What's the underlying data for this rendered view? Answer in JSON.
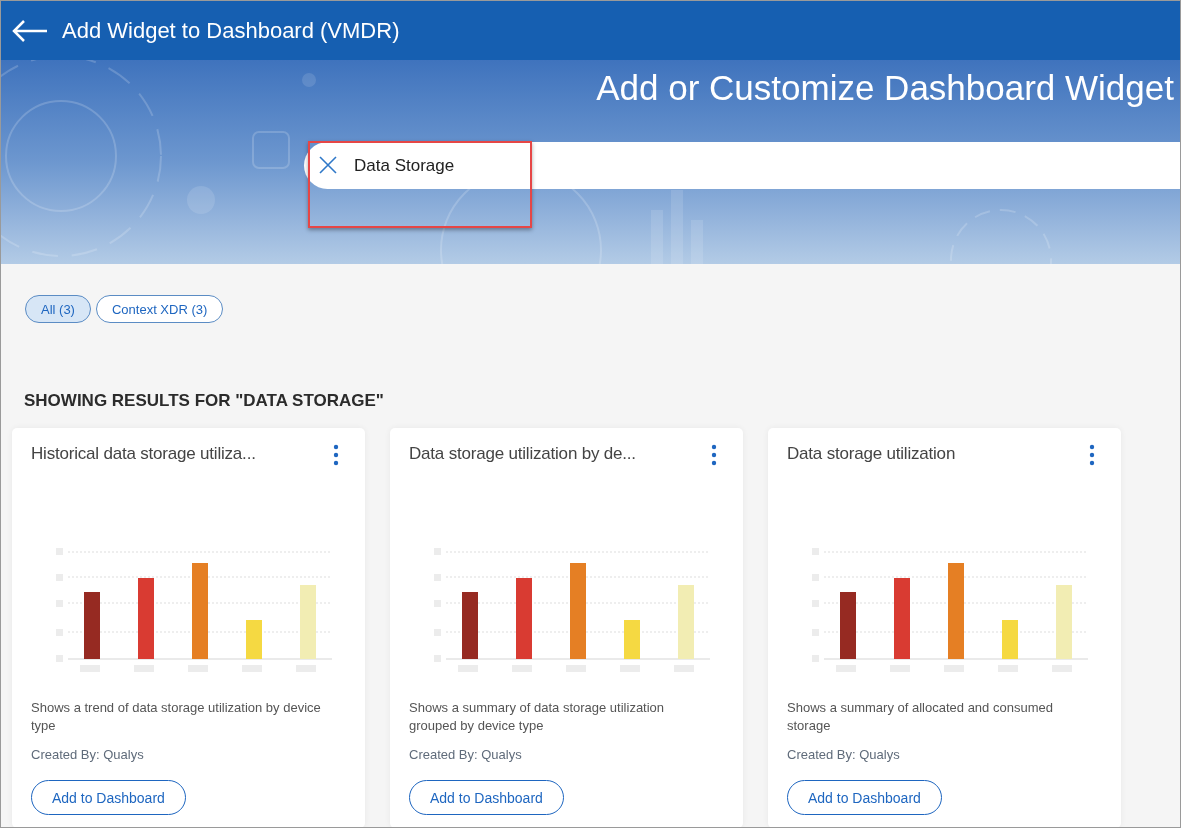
{
  "header": {
    "title": "Add Widget to Dashboard (VMDR)"
  },
  "banner": {
    "heading": "Add or Customize Dashboard Widget",
    "search": {
      "value": "Data Storage",
      "highlighted": true
    }
  },
  "filters": [
    {
      "label": "All (3)",
      "selected": true
    },
    {
      "label": "Context XDR (3)",
      "selected": false
    }
  ],
  "results_heading": "SHOWING RESULTS FOR \"DATA STORAGE\"",
  "cards": [
    {
      "title": "Historical data storage utiliza...",
      "description": "Shows a trend of data storage utilization by device type",
      "created_by": "Created By: Qualys",
      "button": "Add to Dashboard"
    },
    {
      "title": "Data storage utilization by de...",
      "description": "Shows a summary of data storage utilization grouped by device type",
      "created_by": "Created By: Qualys",
      "button": "Add to Dashboard"
    },
    {
      "title": "Data storage utilization",
      "description": "Shows a summary of allocated and consumed storage",
      "created_by": "Created By: Qualys",
      "button": "Add to Dashboard"
    }
  ]
}
